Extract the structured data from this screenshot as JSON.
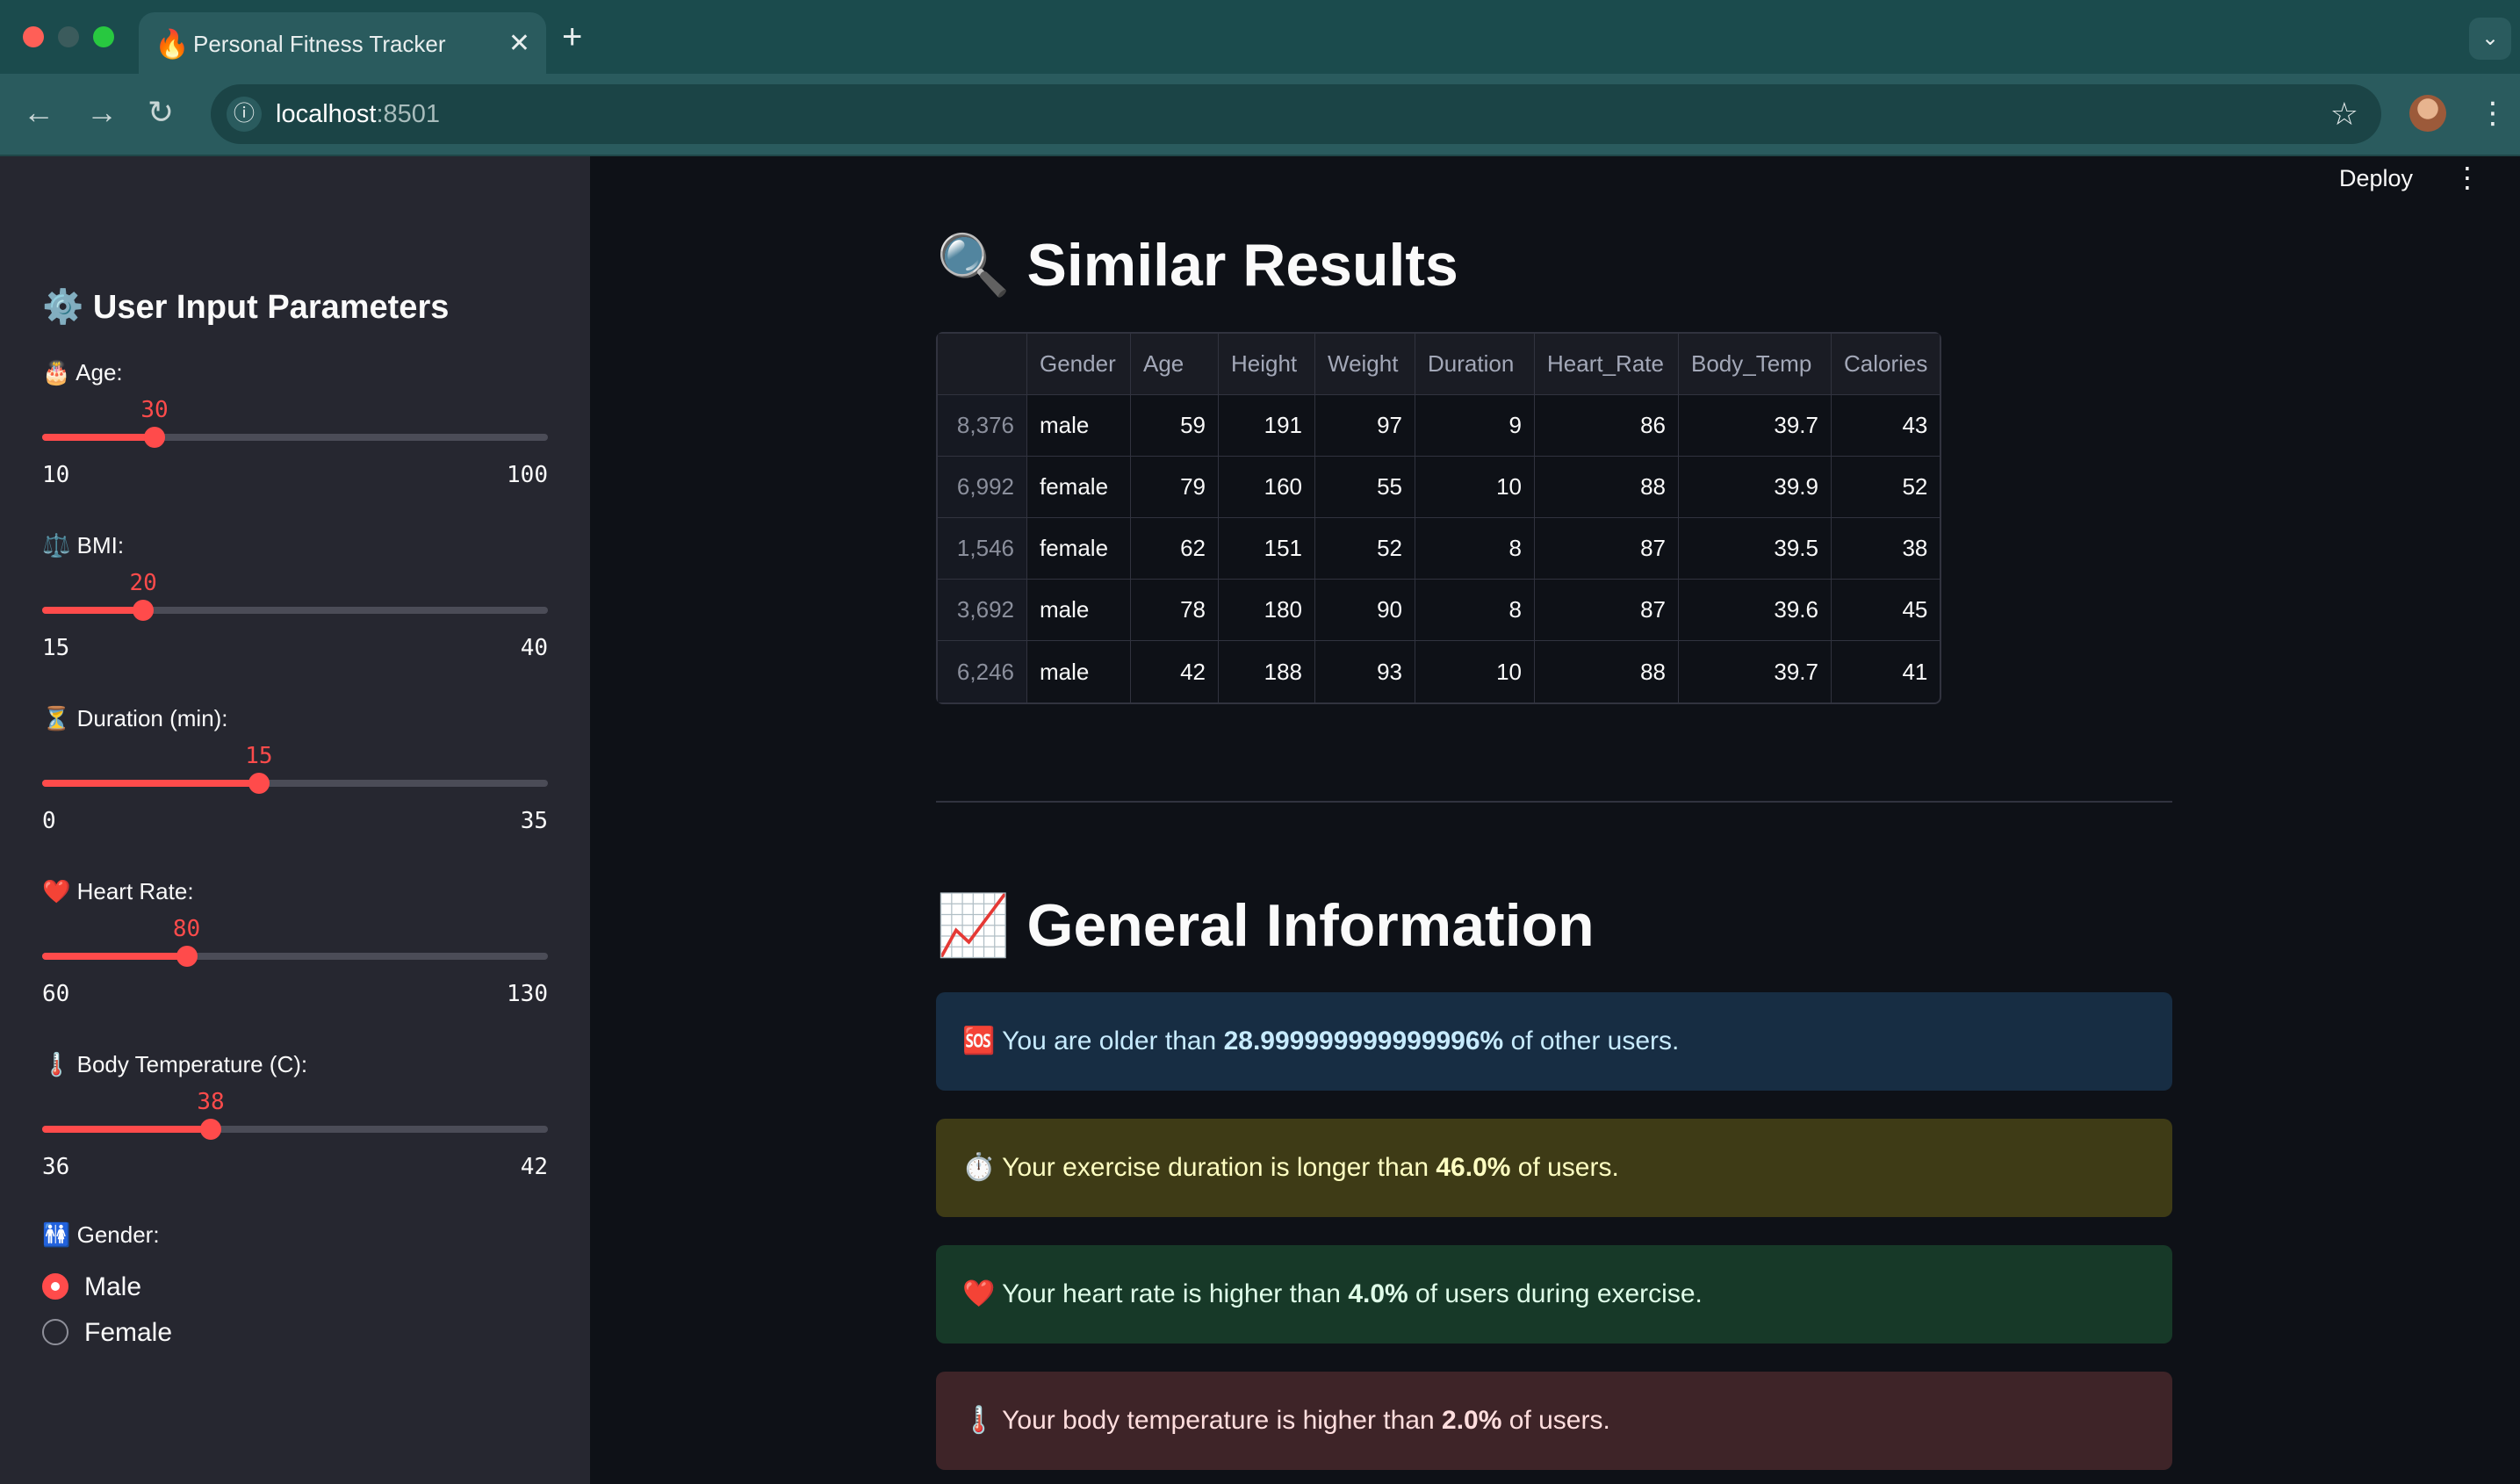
{
  "browser": {
    "tab_title": "Personal Fitness Tracker",
    "tab_icon": "🔥",
    "url_host": "localhost",
    "url_port": ":8501"
  },
  "app": {
    "deploy_label": "Deploy"
  },
  "sidebar": {
    "title": "⚙️ User Input Parameters",
    "sliders": [
      {
        "label": "🎂 Age:",
        "value": "30",
        "min": "10",
        "max": "100",
        "fraction": 0.2222
      },
      {
        "label": "⚖️ BMI:",
        "value": "20",
        "min": "15",
        "max": "40",
        "fraction": 0.2
      },
      {
        "label": "⏳ Duration (min):",
        "value": "15",
        "min": "0",
        "max": "35",
        "fraction": 0.4286
      },
      {
        "label": "❤️ Heart Rate:",
        "value": "80",
        "min": "60",
        "max": "130",
        "fraction": 0.2857
      },
      {
        "label": "🌡️ Body Temperature (C):",
        "value": "38",
        "min": "36",
        "max": "42",
        "fraction": 0.3333
      }
    ],
    "gender": {
      "label": "🚻 Gender:",
      "options": [
        "Male",
        "Female"
      ],
      "selected": "Male"
    }
  },
  "similar": {
    "heading": "🔍 Similar Results",
    "columns": [
      "",
      "Gender",
      "Age",
      "Height",
      "Weight",
      "Duration",
      "Heart_Rate",
      "Body_Temp",
      "Calories"
    ],
    "rows": [
      [
        "8,376",
        "male",
        "59",
        "191",
        "97",
        "9",
        "86",
        "39.7",
        "43"
      ],
      [
        "6,992",
        "female",
        "79",
        "160",
        "55",
        "10",
        "88",
        "39.9",
        "52"
      ],
      [
        "1,546",
        "female",
        "62",
        "151",
        "52",
        "8",
        "87",
        "39.5",
        "38"
      ],
      [
        "3,692",
        "male",
        "78",
        "180",
        "90",
        "8",
        "87",
        "39.6",
        "45"
      ],
      [
        "6,246",
        "male",
        "42",
        "188",
        "93",
        "10",
        "88",
        "39.7",
        "41"
      ]
    ]
  },
  "general": {
    "heading": "📈 General Information",
    "alerts": [
      {
        "icon": "🆘",
        "before": "You are older than ",
        "value": "28.999999999999996%",
        "after": " of other users.",
        "bg": "#172d43",
        "color": "#c7ebff"
      },
      {
        "icon": "⏱️",
        "before": "Your exercise duration is longer than ",
        "value": "46.0%",
        "after": " of users.",
        "bg": "#3e3b16",
        "color": "#ffffc2"
      },
      {
        "icon": "❤️",
        "before": "Your heart rate is higher than ",
        "value": "4.0%",
        "after": " of users during exercise.",
        "bg": "#173928",
        "color": "#dffde9"
      },
      {
        "icon": "🌡️",
        "before": "Your body temperature is higher than ",
        "value": "2.0%",
        "after": " of users.",
        "bg": "#3e2428",
        "color": "#ffdede"
      }
    ]
  }
}
